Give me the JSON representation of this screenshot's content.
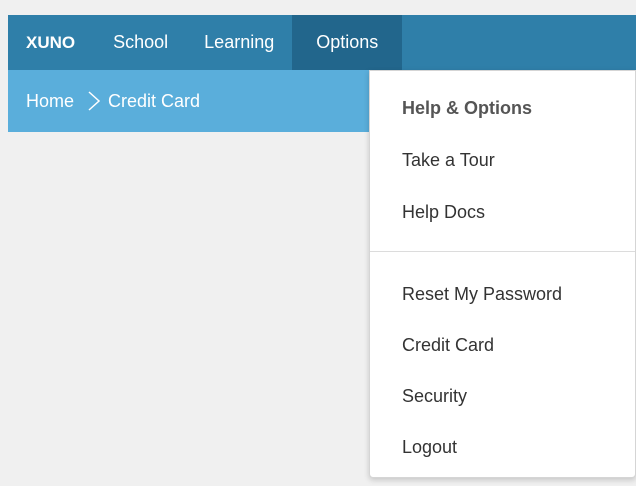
{
  "topnav": {
    "logo": "XUNO",
    "items": [
      {
        "label": "School"
      },
      {
        "label": "Learning"
      },
      {
        "label": "Options"
      }
    ]
  },
  "breadcrumb": {
    "home": "Home",
    "current": "Credit Card"
  },
  "dropdown": {
    "header": "Help & Options",
    "items": [
      {
        "label": "Take a Tour"
      },
      {
        "label": "Help Docs"
      },
      {
        "label": "Reset My Password"
      },
      {
        "label": "Credit Card"
      },
      {
        "label": "Security"
      },
      {
        "label": "Logout"
      }
    ]
  },
  "colors": {
    "topbar": "#2f7fa9",
    "active_tab": "#22668c",
    "breadcrumb_bar": "#5aaedb",
    "background": "#f0f0f0"
  }
}
